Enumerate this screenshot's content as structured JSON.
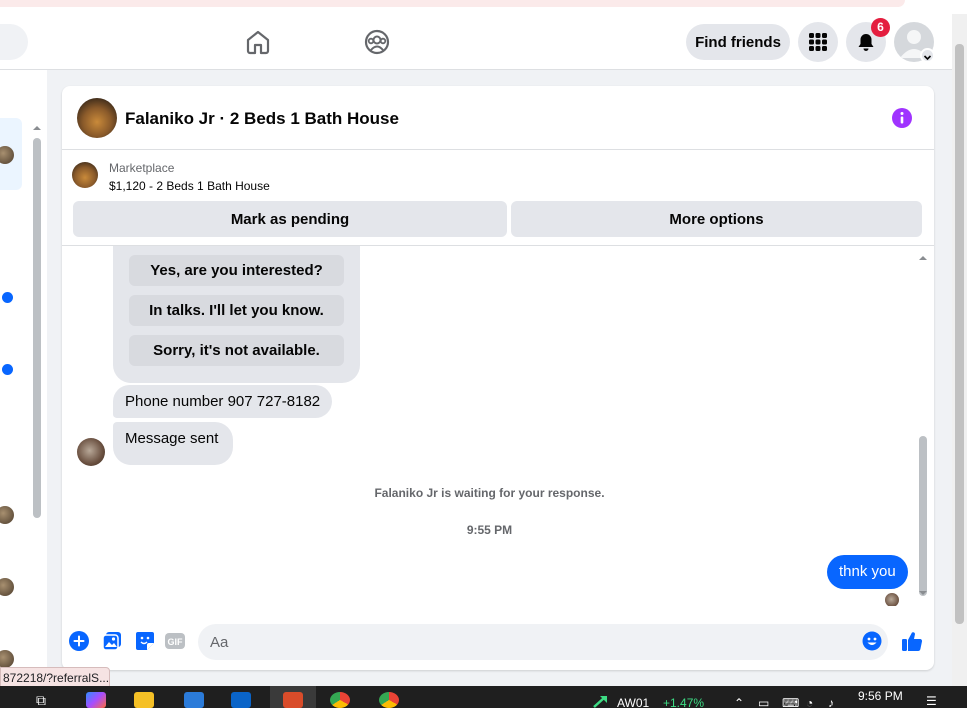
{
  "topnav": {
    "find_friends_label": "Find friends",
    "notification_count": "6"
  },
  "chat": {
    "title": "Falaniko Jr · 2 Beds 1 Bath House",
    "marketplace": {
      "label": "Marketplace",
      "listing": "$1,120 - 2 Beds 1 Bath House"
    },
    "actions": {
      "mark_pending_label": "Mark as pending",
      "more_options_label": "More options"
    },
    "quick_replies": [
      "Yes, are you interested?",
      "In talks. I'll let you know.",
      "Sorry, it's not available."
    ],
    "messages": {
      "phone": "Phone number 907 727-8182",
      "sent": "Message sent",
      "waiting": "Falaniko Jr is waiting for your response.",
      "time": "9:55 PM",
      "outgoing": "thnk you"
    },
    "composer": {
      "placeholder": "Aa"
    },
    "colors": {
      "accent": "#0866ff",
      "info": "#a033ff"
    }
  },
  "status_bar": {
    "url": "872218/?referralS..."
  },
  "taskbar": {
    "ticker_symbol": "AW01",
    "ticker_change": "+1.47%",
    "clock": "9:56 PM"
  }
}
